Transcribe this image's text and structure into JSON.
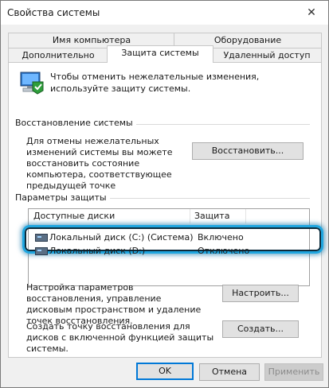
{
  "window": {
    "title": "Свойства системы"
  },
  "tabs_row1": [
    {
      "label": "Имя компьютера"
    },
    {
      "label": "Оборудование"
    }
  ],
  "tabs_row2": [
    {
      "label": "Дополнительно"
    },
    {
      "label": "Защита системы"
    },
    {
      "label": "Удаленный доступ"
    }
  ],
  "intro": {
    "text": "Чтобы отменить нежелательные изменения, используйте защиту системы."
  },
  "restore": {
    "heading": "Восстановление системы",
    "text": "Для отмены нежелательных изменений системы вы можете восстановить состояние компьютера, соответствующее предыдущей точке восстановления.",
    "button": "Восстановить..."
  },
  "protection": {
    "heading": "Параметры защиты",
    "columns": [
      "Доступные диски",
      "Защита"
    ],
    "rows": [
      {
        "name": "Локальный диск (C:) (Система)",
        "status": "Включено"
      },
      {
        "name": "Локальный диск (D:)",
        "status": "Отключено"
      }
    ]
  },
  "configure": {
    "text": "Настройка параметров восстановления, управление дисковым пространством и удаление точек восстановления.",
    "button": "Настроить..."
  },
  "create": {
    "text": "Создать точку восстановления для дисков с включенной функцией защиты системы.",
    "button": "Создать..."
  },
  "footer": {
    "ok": "OK",
    "cancel": "Отмена",
    "apply": "Применить"
  }
}
